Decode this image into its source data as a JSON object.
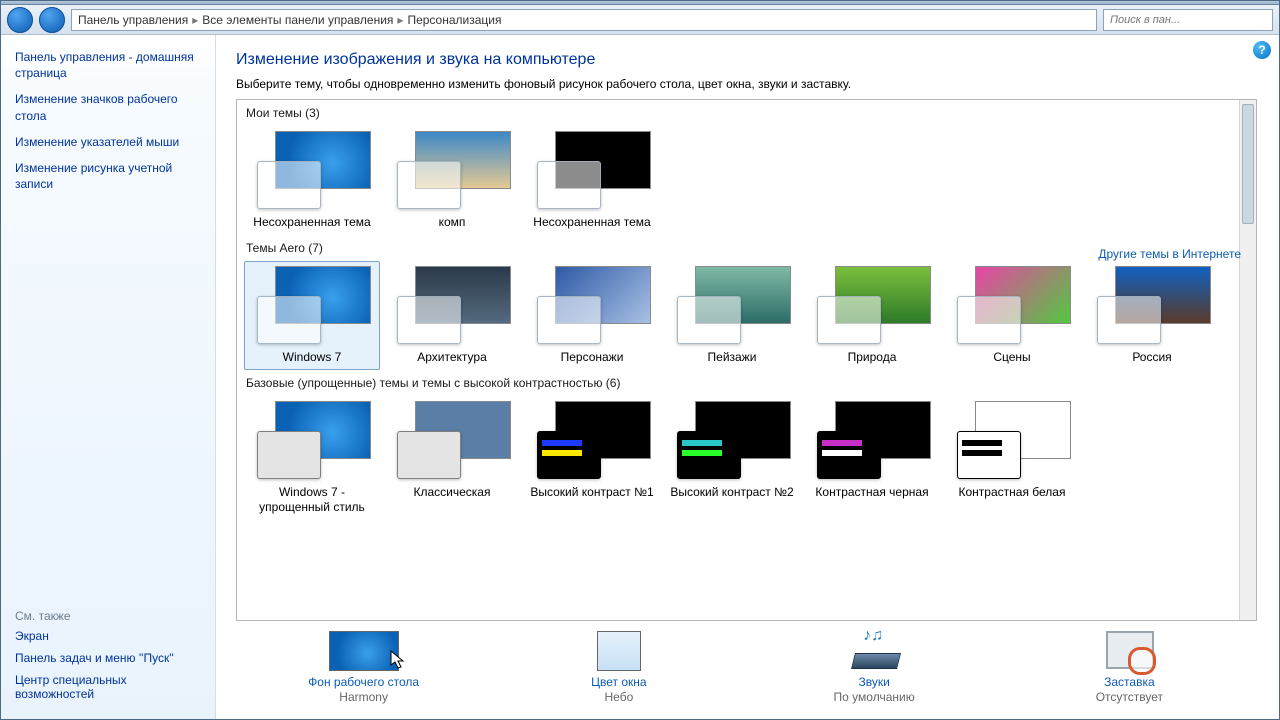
{
  "breadcrumb": {
    "a": "Панель управления",
    "b": "Все элементы панели управления",
    "c": "Персонализация"
  },
  "search": {
    "placeholder": "Поиск в пан..."
  },
  "sidebar": {
    "home": "Панель управления - домашняя страница",
    "links": [
      "Изменение значков рабочего стола",
      "Изменение указателей мыши",
      "Изменение рисунка учетной записи"
    ],
    "seeAlsoHeader": "См. также",
    "seeAlso": [
      "Экран",
      "Панель задач и меню ''Пуск''",
      "Центр специальных возможностей"
    ]
  },
  "heading": "Изменение изображения и звука на компьютере",
  "subtitle": "Выберите тему, чтобы одновременно изменить фоновый рисунок рабочего стола, цвет окна, звуки и заставку.",
  "sections": {
    "my": {
      "header": "Мои темы (3)",
      "themes": [
        "Несохраненная тема",
        "комп",
        "Несохраненная тема"
      ]
    },
    "aeroLink": "Другие темы в Интернете",
    "aero": {
      "header": "Темы Aero (7)",
      "themes": [
        "Windows 7",
        "Архитектура",
        "Персонажи",
        "Пейзажи",
        "Природа",
        "Сцены",
        "Россия"
      ]
    },
    "basic": {
      "header": "Базовые (упрощенные) темы и темы с высокой контрастностью (6)",
      "themes": [
        "Windows 7 - упрощенный стиль",
        "Классическая",
        "Высокий контраст №1",
        "Высокий контраст №2",
        "Контрастная черная",
        "Контрастная белая"
      ]
    }
  },
  "bottom": {
    "bg": {
      "title": "Фон рабочего стола",
      "value": "Harmony"
    },
    "color": {
      "title": "Цвет окна",
      "value": "Небо"
    },
    "sounds": {
      "title": "Звуки",
      "value": "По умолчанию"
    },
    "saver": {
      "title": "Заставка",
      "value": "Отсутствует"
    }
  }
}
